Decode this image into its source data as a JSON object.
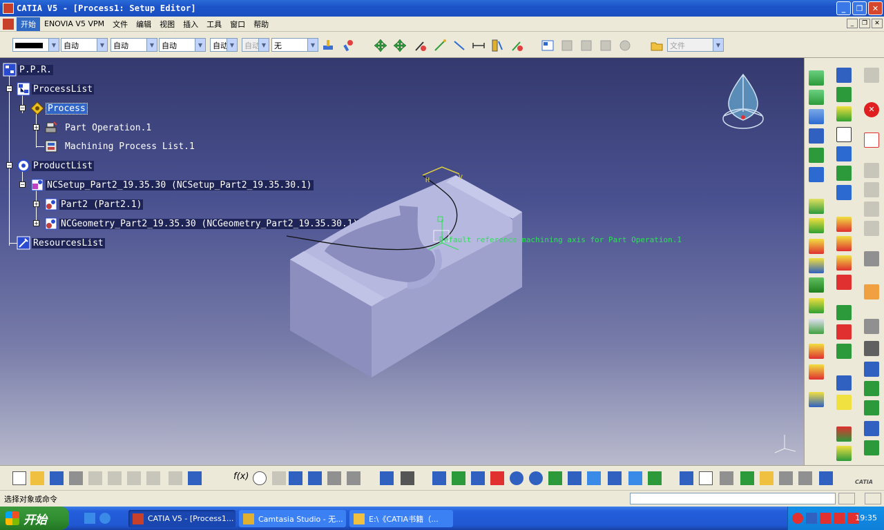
{
  "titlebar": {
    "title": "CATIA V5 - [Process1: Setup Editor]",
    "minimize": "_",
    "restore": "❐",
    "close": "✕"
  },
  "menubar": {
    "items": [
      "开始",
      "ENOVIA V5 VPM",
      "文件",
      "编辑",
      "视图",
      "插入",
      "工具",
      "窗口",
      "帮助"
    ]
  },
  "toolbar1": {
    "linetype": "",
    "thickness": "自动",
    "layer": "自动",
    "style": "自动",
    "weight": "自动",
    "disabled_combo": "自动",
    "filter": "无",
    "file_combo": "文件"
  },
  "tree": {
    "root": "P.P.R.",
    "processlist": "ProcessList",
    "process": "Process",
    "part_operation": "Part Operation.1",
    "machining_process": "Machining Process List.1",
    "productlist": "ProductList",
    "ncsetup": "NCSetup_Part2_19.35.30 (NCSetup_Part2_19.35.30.1)",
    "part2": "Part2 (Part2.1)",
    "ncgeometry": "NCGeometry_Part2_19.35.30 (NCGeometry_Part2_19.35.30.1)",
    "resourceslist": "ResourcesList"
  },
  "viewport": {
    "axis_annotation": "Default reference machining axis for Part Operation.1",
    "axis_h": "H",
    "axis_v": "V"
  },
  "statusbar": {
    "prompt": "选择对象或命令"
  },
  "taskbar": {
    "start": "开始",
    "tasks": [
      "CATIA V5 - [Process1...",
      "Camtasia Studio - 无...",
      "E:\\《CATIA书籍（..."
    ],
    "clock": "19:35"
  },
  "colors": {
    "accent": "#316ac5",
    "viewport_top": "#343a6e",
    "viewport_bottom": "#b9bacd",
    "part_color": "#a9abd2",
    "annotation_green": "#2fe05a"
  }
}
